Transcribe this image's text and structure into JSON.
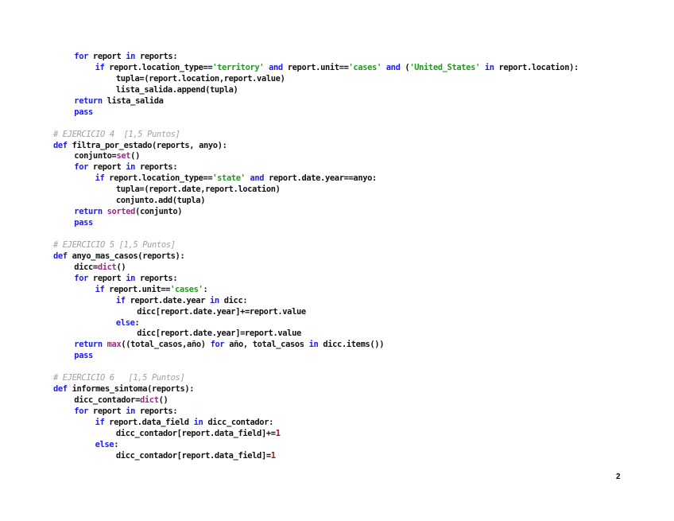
{
  "document": {
    "page_number": "2",
    "code_lines": [
      {
        "indent": 1,
        "tokens": [
          [
            "kw",
            "for"
          ],
          [
            "t",
            " report "
          ],
          [
            "kw",
            "in"
          ],
          [
            "t",
            " reports:"
          ]
        ]
      },
      {
        "indent": 2,
        "tokens": [
          [
            "kw",
            "if"
          ],
          [
            "t",
            " report.location_type=="
          ],
          [
            "str",
            "'territory'"
          ],
          [
            "t",
            " "
          ],
          [
            "kw",
            "and"
          ],
          [
            "t",
            " report.unit=="
          ],
          [
            "str",
            "'cases'"
          ],
          [
            "t",
            " "
          ],
          [
            "kw",
            "and"
          ],
          [
            "t",
            " ("
          ],
          [
            "str",
            "'United_States'"
          ],
          [
            "t",
            " "
          ],
          [
            "kw",
            "in"
          ],
          [
            "t",
            " report.location):"
          ]
        ]
      },
      {
        "indent": 3,
        "tokens": [
          [
            "t",
            "tupla=(report.location,report.value)"
          ]
        ]
      },
      {
        "indent": 3,
        "tokens": [
          [
            "t",
            "lista_salida.append(tupla)"
          ]
        ]
      },
      {
        "indent": 1,
        "tokens": [
          [
            "kw",
            "return"
          ],
          [
            "t",
            " lista_salida"
          ]
        ]
      },
      {
        "indent": 1,
        "tokens": [
          [
            "kw",
            "pass"
          ]
        ]
      },
      {
        "indent": 0,
        "tokens": []
      },
      {
        "indent": 0,
        "tokens": [
          [
            "cm",
            "# EJERCICIO 4  [1,5 Puntos]"
          ]
        ]
      },
      {
        "indent": 0,
        "tokens": [
          [
            "kw",
            "def"
          ],
          [
            "t",
            " filtra_por_estado(reports, anyo):"
          ]
        ]
      },
      {
        "indent": 1,
        "tokens": [
          [
            "t",
            "conjunto="
          ],
          [
            "bi",
            "set"
          ],
          [
            "t",
            "()"
          ]
        ]
      },
      {
        "indent": 1,
        "tokens": [
          [
            "kw",
            "for"
          ],
          [
            "t",
            " report "
          ],
          [
            "kw",
            "in"
          ],
          [
            "t",
            " reports:"
          ]
        ]
      },
      {
        "indent": 2,
        "tokens": [
          [
            "kw",
            "if"
          ],
          [
            "t",
            " report.location_type=="
          ],
          [
            "str",
            "'state'"
          ],
          [
            "t",
            " "
          ],
          [
            "kw",
            "and"
          ],
          [
            "t",
            " report.date.year==anyo:"
          ]
        ]
      },
      {
        "indent": 3,
        "tokens": [
          [
            "t",
            "tupla=(report.date,report.location)"
          ]
        ]
      },
      {
        "indent": 3,
        "tokens": [
          [
            "t",
            "conjunto.add(tupla)"
          ]
        ]
      },
      {
        "indent": 1,
        "tokens": [
          [
            "kw",
            "return"
          ],
          [
            "t",
            " "
          ],
          [
            "bi",
            "sorted"
          ],
          [
            "t",
            "(conjunto)"
          ]
        ]
      },
      {
        "indent": 1,
        "tokens": [
          [
            "kw",
            "pass"
          ]
        ]
      },
      {
        "indent": 0,
        "tokens": []
      },
      {
        "indent": 0,
        "tokens": [
          [
            "cm",
            "# EJERCICIO 5 [1,5 Puntos]"
          ]
        ]
      },
      {
        "indent": 0,
        "tokens": [
          [
            "kw",
            "def"
          ],
          [
            "t",
            " anyo_mas_casos(reports):"
          ]
        ]
      },
      {
        "indent": 1,
        "tokens": [
          [
            "t",
            "dicc="
          ],
          [
            "bi",
            "dict"
          ],
          [
            "t",
            "()"
          ]
        ]
      },
      {
        "indent": 1,
        "tokens": [
          [
            "kw",
            "for"
          ],
          [
            "t",
            " report "
          ],
          [
            "kw",
            "in"
          ],
          [
            "t",
            " reports:"
          ]
        ]
      },
      {
        "indent": 2,
        "tokens": [
          [
            "kw",
            "if"
          ],
          [
            "t",
            " report.unit=="
          ],
          [
            "str",
            "'cases'"
          ],
          [
            "t",
            ":"
          ]
        ]
      },
      {
        "indent": 3,
        "tokens": [
          [
            "kw",
            "if"
          ],
          [
            "t",
            " report.date.year "
          ],
          [
            "kw",
            "in"
          ],
          [
            "t",
            " dicc:"
          ]
        ]
      },
      {
        "indent": 4,
        "tokens": [
          [
            "t",
            "dicc[report.date.year]+=report.value"
          ]
        ]
      },
      {
        "indent": 3,
        "tokens": [
          [
            "kw",
            "else"
          ],
          [
            "t",
            ":"
          ]
        ]
      },
      {
        "indent": 4,
        "tokens": [
          [
            "t",
            "dicc[report.date.year]=report.value"
          ]
        ]
      },
      {
        "indent": 1,
        "tokens": [
          [
            "kw",
            "return"
          ],
          [
            "t",
            " "
          ],
          [
            "bi",
            "max"
          ],
          [
            "t",
            "((total_casos,año) "
          ],
          [
            "kw",
            "for"
          ],
          [
            "t",
            " año, total_casos "
          ],
          [
            "kw",
            "in"
          ],
          [
            "t",
            " dicc.items())"
          ]
        ]
      },
      {
        "indent": 1,
        "tokens": [
          [
            "kw",
            "pass"
          ]
        ]
      },
      {
        "indent": 0,
        "tokens": []
      },
      {
        "indent": 0,
        "tokens": [
          [
            "cm",
            "# EJERCICIO 6   [1,5 Puntos]"
          ]
        ]
      },
      {
        "indent": 0,
        "tokens": [
          [
            "kw",
            "def"
          ],
          [
            "t",
            " informes_sintoma(reports):"
          ]
        ]
      },
      {
        "indent": 1,
        "tokens": [
          [
            "t",
            "dicc_contador="
          ],
          [
            "bi",
            "dict"
          ],
          [
            "t",
            "()"
          ]
        ]
      },
      {
        "indent": 1,
        "tokens": [
          [
            "kw",
            "for"
          ],
          [
            "t",
            " report "
          ],
          [
            "kw",
            "in"
          ],
          [
            "t",
            " reports:"
          ]
        ]
      },
      {
        "indent": 2,
        "tokens": [
          [
            "kw",
            "if"
          ],
          [
            "t",
            " report.data_field "
          ],
          [
            "kw",
            "in"
          ],
          [
            "t",
            " dicc_contador:"
          ]
        ]
      },
      {
        "indent": 3,
        "tokens": [
          [
            "t",
            "dicc_contador[report.data_field]+="
          ],
          [
            "num",
            "1"
          ]
        ]
      },
      {
        "indent": 2,
        "tokens": [
          [
            "kw",
            "else"
          ],
          [
            "t",
            ":"
          ]
        ]
      },
      {
        "indent": 3,
        "tokens": [
          [
            "t",
            "dicc_contador[report.data_field]="
          ],
          [
            "num",
            "1"
          ]
        ]
      }
    ]
  }
}
